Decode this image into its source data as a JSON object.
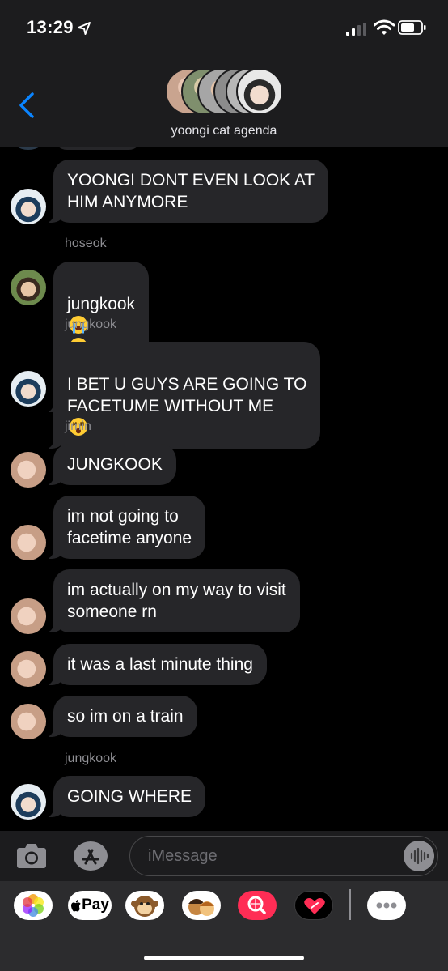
{
  "status_bar": {
    "time": "13:29"
  },
  "header": {
    "group_name": "yoongi cat agenda"
  },
  "messages": [
    {
      "sender": "",
      "text": "YOONGI DONT EVEN LOOK AT\nHIM ANYMORE",
      "avatar": "jungkook-avatar"
    },
    {
      "sender": "hoseok",
      "text": "jungkook",
      "emoji": [
        "loudly-crying-face",
        "loudly-crying-face",
        "loudly-crying-face",
        "loudly-crying-face"
      ],
      "avatar": "hoseok-avatar"
    },
    {
      "sender": "jungkook",
      "text": "I BET U GUYS ARE GOING TO\nFACETUME WITHOUT ME",
      "emoji": [
        "dizzy-face"
      ],
      "avatar": "jungkook-avatar"
    },
    {
      "sender": "jimin",
      "text": "JUNGKOOK",
      "avatar": "jimin-avatar"
    },
    {
      "sender": "",
      "text": "im not going to\nfacetime anyone",
      "avatar": "jimin-avatar"
    },
    {
      "sender": "",
      "text": "im actually on my way to visit\nsomeone rn",
      "avatar": "jimin-avatar"
    },
    {
      "sender": "",
      "text": "it was a last minute thing",
      "avatar": "jimin-avatar"
    },
    {
      "sender": "",
      "text": "so im on a train",
      "avatar": "jimin-avatar"
    },
    {
      "sender": "jungkook",
      "text": "GOING WHERE",
      "avatar": "jungkook-avatar"
    }
  ],
  "input": {
    "placeholder": "iMessage"
  },
  "drawer": {
    "apps": [
      "photos-icon",
      "apple-pay-icon",
      "animoji-icon",
      "memoji-icon",
      "web-search-icon",
      "digital-touch-icon",
      "more-apps-icon"
    ],
    "apple_pay_label": "Pay"
  },
  "colors": {
    "bubble": "#262629",
    "background": "#000000",
    "header": "#1c1c1e",
    "accent": "#0a84ff"
  }
}
